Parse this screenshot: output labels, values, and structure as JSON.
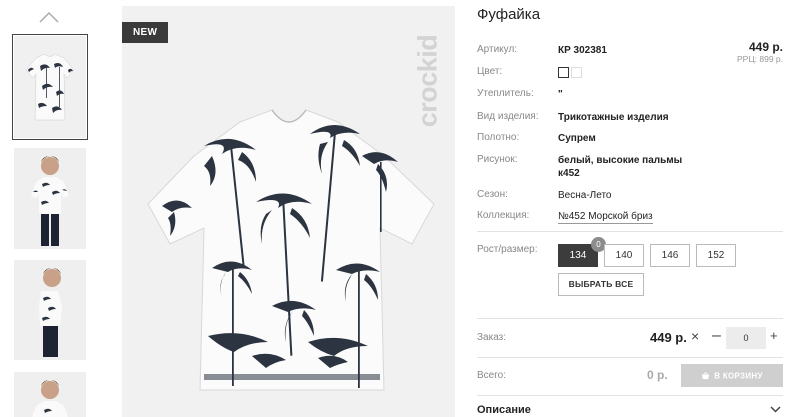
{
  "product": {
    "badge": "NEW",
    "brand": "crockid",
    "title": "Фуфайка",
    "price": "449 р.",
    "rrp": "РРЦ: 899 р."
  },
  "details": [
    {
      "label": "Артикул:",
      "value": "КР 302381"
    },
    {
      "label": "Цвет:",
      "value": ""
    },
    {
      "label": "Утеплитель:",
      "value": "\""
    },
    {
      "label": "Вид изделия:",
      "value": "Трикотажные изделия"
    },
    {
      "label": "Полотно:",
      "value": "Супрем"
    },
    {
      "label": "Рисунок:",
      "value": "белый, высокие пальмы",
      "value2": "к452"
    },
    {
      "label": "Сезон:",
      "value": "Весна-Лето"
    },
    {
      "label": "Коллекция:",
      "value": "№452 Морской бриз"
    }
  ],
  "sizes": {
    "label": "Рост/размер:",
    "options": [
      "134",
      "140",
      "146",
      "152"
    ],
    "selected": "134",
    "selected_count": "0",
    "select_all": "ВЫБРАТЬ ВСЕ"
  },
  "order": {
    "label": "Заказ:",
    "price": "449 р.",
    "times": "×",
    "minus": "–",
    "plus": "+",
    "qty": "0"
  },
  "total": {
    "label": "Всего:",
    "value": "0 р.",
    "cart_button": "В КОРЗИНУ"
  },
  "description": {
    "title": "Описание"
  },
  "icons": {
    "thumb_up": "chevron-up-icon",
    "cart": "basket-icon",
    "desc": "chevron-down-icon"
  },
  "colors": {
    "accent_dark": "#3c3c3c",
    "cart_disabled": "#cfcfcf",
    "print": "#2b3440"
  }
}
